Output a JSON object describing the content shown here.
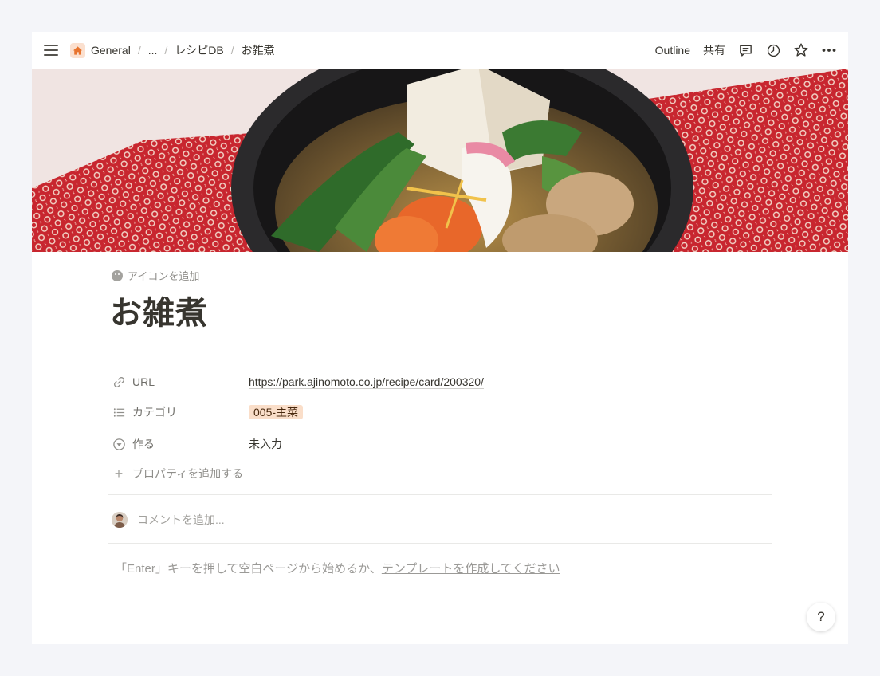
{
  "breadcrumb": {
    "items": [
      "General",
      "...",
      "レシピDB",
      "お雑煮"
    ],
    "separator": "/"
  },
  "header_actions": {
    "outline_label": "Outline",
    "share_label": "共有",
    "icons": [
      "comment-icon",
      "history-icon",
      "star-icon",
      "more-icon"
    ]
  },
  "page": {
    "add_icon_label": "アイコンを追加",
    "title": "お雑煮",
    "properties": [
      {
        "icon": "link-icon",
        "name": "URL",
        "value": "https://park.ajinomoto.co.jp/recipe/card/200320/"
      },
      {
        "icon": "list-icon",
        "name": "カテゴリ",
        "value": "005-主菜"
      },
      {
        "icon": "status-icon",
        "name": "作る",
        "value": "未入力"
      }
    ],
    "add_property_label": "プロパティを追加する",
    "comment_placeholder": "コメントを追加...",
    "empty_hint_prefix": "「Enter」キーを押して空白ページから始めるか、",
    "empty_hint_link": "テンプレートを作成してください"
  },
  "help_label": "?",
  "colors": {
    "background": "#f4f5f9",
    "tag_background": "#fadec9",
    "home_icon_background": "#fbe0cf",
    "home_icon_color": "#e8742e"
  }
}
